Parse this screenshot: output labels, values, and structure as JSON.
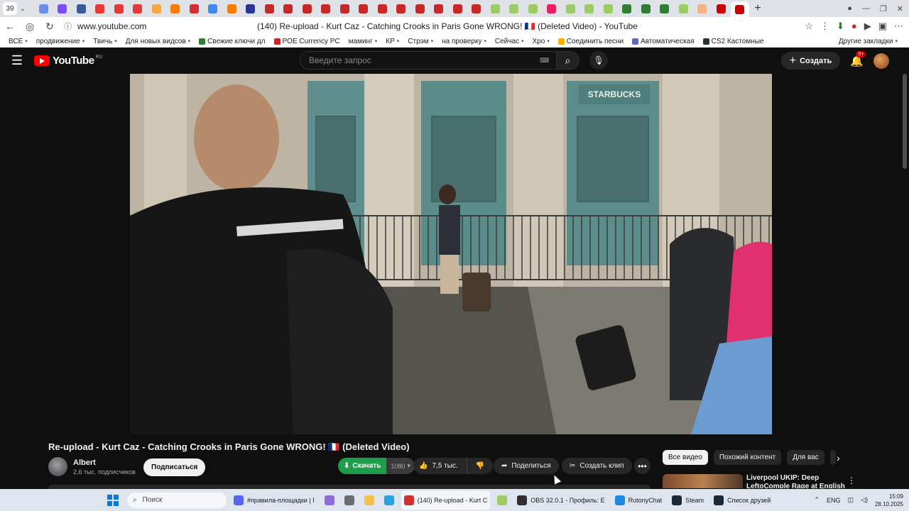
{
  "browser": {
    "tab_count": "39",
    "page_title": "(140) Re-upload - Kurt Caz - Catching Crooks in Paris Gone WRONG! 🇫🇷 (Deleted Video) - YouTube",
    "url": "www.youtube.com",
    "tab_favicon_colors": [
      "#6b8ee8",
      "#7c4dff",
      "#3b5998",
      "#e53935",
      "#e53935",
      "#e53935",
      "#f4a742",
      "#f57c00",
      "#d32f2f",
      "#4285f4",
      "#f57c00",
      "#283593",
      "#c62828",
      "#c62828",
      "#c62828",
      "#c62828",
      "#c62828",
      "#c62828",
      "#c62828",
      "#c62828",
      "#c62828",
      "#c62828",
      "#c62828",
      "#c62828",
      "#9ccc65",
      "#9ccc65",
      "#9ccc65",
      "#e91e63",
      "#9ccc65",
      "#9ccc65",
      "#9ccc65",
      "#2e7d32",
      "#2e7d32",
      "#2e7d32",
      "#9ccc65",
      "#f4b183",
      "#cc0000",
      "#cc0000"
    ]
  },
  "bookmarks": [
    {
      "label": "ВСЕ",
      "dropdown": true
    },
    {
      "label": "продвижение",
      "dropdown": true
    },
    {
      "label": "Твичь",
      "dropdown": true
    },
    {
      "label": "Для новых видсов",
      "dropdown": true
    },
    {
      "label": "Свежие ключи дл",
      "dropdown": false,
      "color": "#2e7d32"
    },
    {
      "label": "POE Currency PC",
      "dropdown": false,
      "color": "#c62828"
    },
    {
      "label": "маминг",
      "dropdown": true
    },
    {
      "label": "КР",
      "dropdown": true
    },
    {
      "label": "Стрэм",
      "dropdown": true
    },
    {
      "label": "на проверку",
      "dropdown": true
    },
    {
      "label": "Сейчас",
      "dropdown": true
    },
    {
      "label": "Хро",
      "dropdown": true
    },
    {
      "label": "Соединить песни",
      "dropdown": false,
      "color": "#ffb300"
    },
    {
      "label": "Автоматическая",
      "dropdown": false,
      "color": "#5c6bc0"
    },
    {
      "label": "CS2 Кастомные",
      "dropdown": false,
      "color": "#263238"
    }
  ],
  "bookmarks_other": "Другие закладки",
  "youtube": {
    "logo_text": "YouTube",
    "region": "RU",
    "search_placeholder": "Введите запрос",
    "create_label": "Создать",
    "notif_badge": "9+"
  },
  "video": {
    "title": "Re-upload - Kurt Caz - Catching Crooks in Paris Gone WRONG! 🇫🇷 (Deleted Video)",
    "sign_text": "STARBUCKS",
    "channel_name": "Albert",
    "channel_subs": "2,6 тыс. подписчиков",
    "subscribe_label": "Подписаться",
    "download_label": "Скачать",
    "download_quality": "1080",
    "likes": "7,5 тыс.",
    "share_label": "Поделиться",
    "clip_label": "Создать клип"
  },
  "chips": [
    "Все видео",
    "Похожий контент",
    "Для вас"
  ],
  "recommendation": {
    "title": "Liverpool UKIP: Deep LeftoComple Rage at English"
  },
  "taskbar": {
    "search_placeholder": "Поиск",
    "apps": [
      {
        "label": "#правила-площадки | I",
        "color": "#5865f2"
      },
      {
        "label": "",
        "color": "#8e6bd8"
      },
      {
        "label": "",
        "color": "#6d6d6d"
      },
      {
        "label": "",
        "color": "#f2c14e"
      },
      {
        "label": "",
        "color": "#2aa3df"
      },
      {
        "label": "(140) Re-upload - Kurt C",
        "color": "#d32f2f",
        "active": true
      },
      {
        "label": "",
        "color": "#9ccc65"
      },
      {
        "label": "OBS 32.0.1 - Профиль: E",
        "color": "#302e31"
      },
      {
        "label": "RutonyChat",
        "color": "#1e88e5"
      },
      {
        "label": "Steam",
        "color": "#1b2838"
      },
      {
        "label": "Список друзей",
        "color": "#1b2838"
      }
    ],
    "lang": "ENG",
    "time": "15:09",
    "date": "28.10.2025"
  }
}
